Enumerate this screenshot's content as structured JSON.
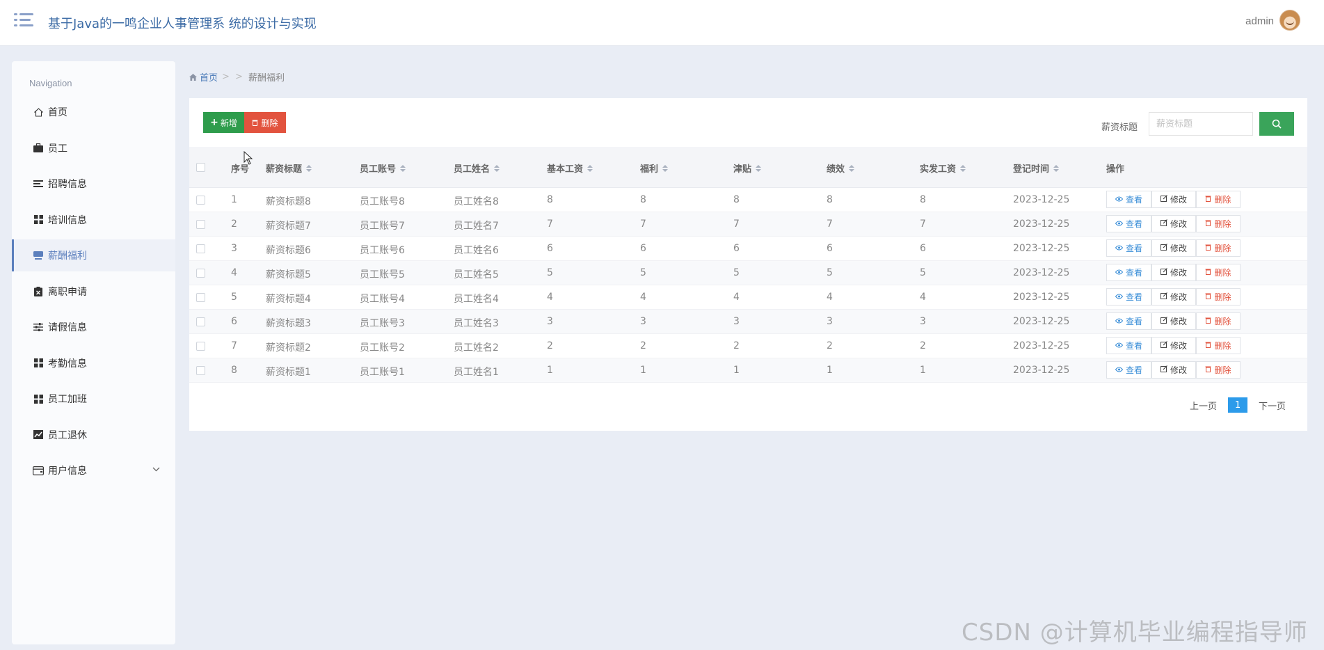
{
  "header": {
    "title": "基于Java的一鸣企业人事管理系 统的设计与实现",
    "user": "admin"
  },
  "sidebar": {
    "caption": "Navigation",
    "items": [
      {
        "label": "首页",
        "icon": "home-icon"
      },
      {
        "label": "员工",
        "icon": "briefcase-icon"
      },
      {
        "label": "招聘信息",
        "icon": "list-icon"
      },
      {
        "label": "培训信息",
        "icon": "grid-icon"
      },
      {
        "label": "薪酬福利",
        "icon": "server-icon",
        "active": true
      },
      {
        "label": "离职申请",
        "icon": "clipboard-icon"
      },
      {
        "label": "请假信息",
        "icon": "sliders-icon"
      },
      {
        "label": "考勤信息",
        "icon": "grid-icon"
      },
      {
        "label": "员工加班",
        "icon": "grid-icon"
      },
      {
        "label": "员工退休",
        "icon": "chart-icon"
      },
      {
        "label": "用户信息",
        "icon": "wallet-icon",
        "has_children": true
      }
    ]
  },
  "breadcrumb": {
    "home": "首页",
    "separator": "> >",
    "current": "薪酬福利"
  },
  "toolbar": {
    "add_label": "新增",
    "delete_label": "删除",
    "search_label": "薪资标题",
    "search_placeholder": "薪资标题"
  },
  "table": {
    "headers": [
      "序号",
      "薪资标题",
      "员工账号",
      "员工姓名",
      "基本工资",
      "福利",
      "津贴",
      "绩效",
      "实发工资",
      "登记时间",
      "操作"
    ],
    "rows": [
      [
        "1",
        "薪资标题8",
        "员工账号8",
        "员工姓名8",
        "8",
        "8",
        "8",
        "8",
        "8",
        "2023-12-25"
      ],
      [
        "2",
        "薪资标题7",
        "员工账号7",
        "员工姓名7",
        "7",
        "7",
        "7",
        "7",
        "7",
        "2023-12-25"
      ],
      [
        "3",
        "薪资标题6",
        "员工账号6",
        "员工姓名6",
        "6",
        "6",
        "6",
        "6",
        "6",
        "2023-12-25"
      ],
      [
        "4",
        "薪资标题5",
        "员工账号5",
        "员工姓名5",
        "5",
        "5",
        "5",
        "5",
        "5",
        "2023-12-25"
      ],
      [
        "5",
        "薪资标题4",
        "员工账号4",
        "员工姓名4",
        "4",
        "4",
        "4",
        "4",
        "4",
        "2023-12-25"
      ],
      [
        "6",
        "薪资标题3",
        "员工账号3",
        "员工姓名3",
        "3",
        "3",
        "3",
        "3",
        "3",
        "2023-12-25"
      ],
      [
        "7",
        "薪资标题2",
        "员工账号2",
        "员工姓名2",
        "2",
        "2",
        "2",
        "2",
        "2",
        "2023-12-25"
      ],
      [
        "8",
        "薪资标题1",
        "员工账号1",
        "员工姓名1",
        "1",
        "1",
        "1",
        "1",
        "1",
        "2023-12-25"
      ]
    ],
    "actions": {
      "view": "查看",
      "edit": "修改",
      "delete": "删除"
    }
  },
  "pagination": {
    "prev": "上一页",
    "current": "1",
    "next": "下一页"
  },
  "watermark": "CSDN @计算机毕业编程指导师",
  "colors": {
    "add": "#2e9c4c",
    "delete": "#e2533e",
    "search": "#3aa45a",
    "active_page": "#2c9bea",
    "title": "#3d6ca6"
  }
}
